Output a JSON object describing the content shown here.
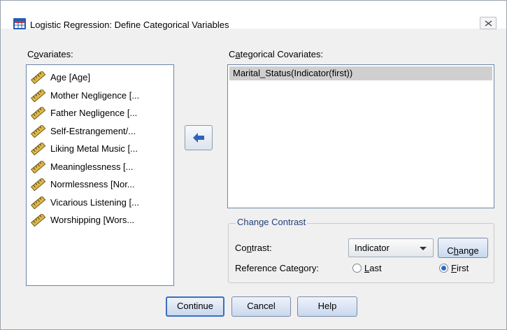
{
  "window": {
    "title": "Logistic Regression: Define Categorical Variables"
  },
  "covariates": {
    "label_pre": "C",
    "label_u": "o",
    "label_post": "variates:",
    "items": [
      "Age [Age]",
      "Mother Negligence [...",
      "Father Negligence [...",
      "Self-Estrangement/...",
      "Liking Metal Music [...",
      "Meaninglessness [...",
      "Normlessness [Nor...",
      "Vicarious Listening [...",
      "Worshipping [Wors..."
    ]
  },
  "categorical": {
    "label_pre": "C",
    "label_u": "a",
    "label_post": "tegorical Covariates:",
    "items": [
      "Marital_Status(Indicator(first))"
    ]
  },
  "change_contrast": {
    "title": "Change Contrast",
    "contrast_label_pre": "Co",
    "contrast_label_u": "n",
    "contrast_label_post": "trast:",
    "contrast_value": "Indicator",
    "change_pre": "C",
    "change_u": "h",
    "change_post": "ange",
    "reference_label": "Reference Category:",
    "last_u": "L",
    "last_post": "ast",
    "first_u": "F",
    "first_post": "irst",
    "selected": "First"
  },
  "buttons": {
    "continue": "Continue",
    "cancel": "Cancel",
    "help": "Help"
  },
  "colors": {
    "accent": "#2a6ad1",
    "selection": "#cfcfcf",
    "group_title": "#1f3f7a"
  }
}
